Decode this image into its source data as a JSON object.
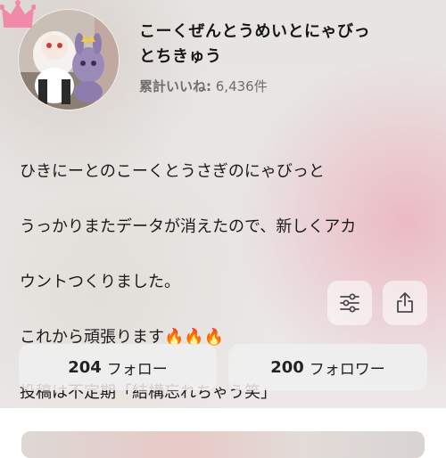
{
  "profile": {
    "name_line1": "こーくぜんとうめいとにゃびっ",
    "name_line2": "とちきゅう",
    "likes_label": "累計いいね:",
    "likes_value": " 6,436件"
  },
  "bio": {
    "line1": "ひきにーとのこーくとうさぎのにゃびっと",
    "line2": "うっかりまたデータが消えたので、新しくアカ",
    "line3": "ウントつくりました。",
    "line4": "これから頑張ります🔥🔥🔥",
    "line5": "投稿は不定期「結構忘れちゃう笑」"
  },
  "actions": {
    "settings_icon": "sliders-icon",
    "share_icon": "share-icon"
  },
  "stats": {
    "following_count": "204",
    "following_label": "フォロー",
    "followers_count": "200",
    "followers_label": "フォロワー"
  },
  "colors": {
    "crown": "#f08aa8",
    "text": "#1a1a1a",
    "muted": "#6e6e6e"
  }
}
